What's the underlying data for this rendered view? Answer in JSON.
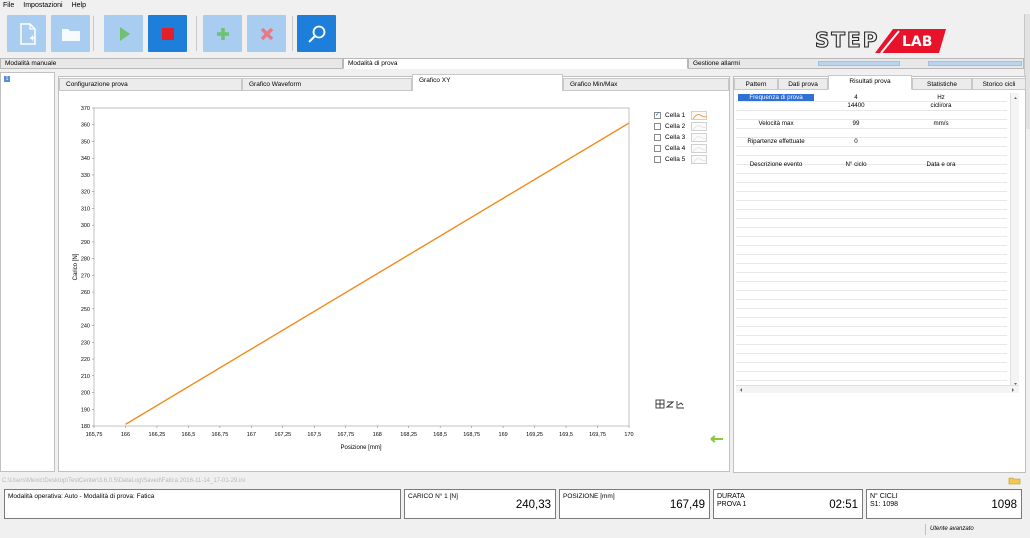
{
  "menu": {
    "file": "File",
    "settings": "Impostazioni",
    "help": "Help"
  },
  "toolbar": {
    "buttons": [
      "new-file-icon",
      "open-folder-icon",
      "play-icon",
      "stop-icon",
      "add-icon",
      "delete-icon",
      "search-icon"
    ],
    "accent": "#1e7fda"
  },
  "logo": {
    "text_left": "STEP",
    "text_right": "LAB",
    "accent": "#e8122a"
  },
  "modes": {
    "manual": "Modalità manuale",
    "test": "Modalità di prova",
    "alarms": "Gestione allarmi"
  },
  "left_panel": {
    "index": "1"
  },
  "center_tabs": [
    "Configurazione prova",
    "Grafico Waveform",
    "Grafico XY",
    "Grafico Min/Max"
  ],
  "right_tabs": [
    "Pattern",
    "Dati prova",
    "Risultati prova",
    "Statistiche",
    "Storico cicli"
  ],
  "results": {
    "freq_label": "Frequenza di prova",
    "freq_value": "4",
    "freq_unit": "Hz",
    "cycles_value": "14400",
    "cycles_unit": "cicli/ora",
    "vel_label": "Velocità max",
    "vel_value": "99",
    "vel_unit": "mm/s",
    "restarts_label": "Ripartenze effettuate",
    "restarts_value": "0",
    "event_col": "Descrizione evento",
    "cycle_col": "N° ciclo",
    "date_col": "Data e ora"
  },
  "legend": {
    "items": [
      {
        "label": "Cella 1",
        "checked": true
      },
      {
        "label": "Cella 2",
        "checked": false
      },
      {
        "label": "Cella 3",
        "checked": false
      },
      {
        "label": "Cella 4",
        "checked": false
      },
      {
        "label": "Cella 5",
        "checked": false
      }
    ],
    "series_color": "#f28a1c"
  },
  "chart_data": {
    "type": "line",
    "xlabel": "Posizione [mm]",
    "ylabel": "Carico [N]",
    "xlim": [
      165.75,
      170
    ],
    "ylim": [
      180,
      370
    ],
    "xticks": [
      "165,75",
      "166",
      "166,25",
      "166,5",
      "166,75",
      "167",
      "167,25",
      "167,5",
      "167,75",
      "168",
      "168,25",
      "168,5",
      "168,75",
      "169",
      "169,25",
      "169,5",
      "169,75",
      "170"
    ],
    "yticks": [
      "180",
      "190",
      "200",
      "210",
      "220",
      "230",
      "240",
      "250",
      "260",
      "270",
      "280",
      "290",
      "300",
      "310",
      "320",
      "330",
      "340",
      "350",
      "360",
      "370"
    ],
    "series": [
      {
        "name": "Cella 1",
        "color": "#f28a1c",
        "x": [
          166,
          170
        ],
        "y": [
          181,
          361
        ]
      }
    ]
  },
  "path": "C:\\Users\\Mexic\\Desktop\\TestCenter\\3.6.0.5\\DataLog\\Saved\\Fatica 2016-11-14_17-01-29.ini",
  "status": {
    "mode_text": "Modalità operativa: Auto - Modalità di prova: Fatica",
    "load_label": "CARICO N° 1 [N]",
    "load_value": "240,33",
    "position_label": "POSIZIONE [mm]",
    "position_value": "167,49",
    "duration_label_1": "DURATA",
    "duration_label_2": "PROVA 1",
    "duration_value": "02:51",
    "cycles_label_1": "N° CICLI",
    "cycles_label_2": "S1: 1098",
    "cycles_value": "1098"
  },
  "footer": {
    "user": "Utente avanzato"
  }
}
